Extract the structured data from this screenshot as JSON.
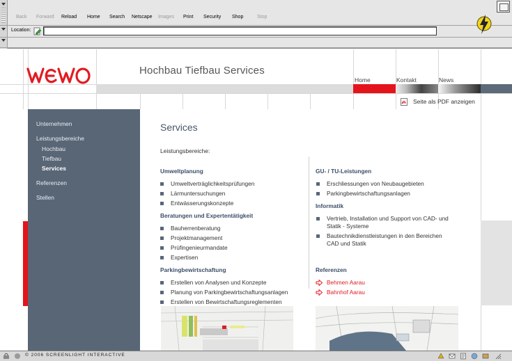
{
  "browser": {
    "toolbar": [
      {
        "label": "Back",
        "enabled": false
      },
      {
        "label": "Forward",
        "enabled": false
      },
      {
        "label": "Reload",
        "enabled": true
      },
      {
        "label": "Home",
        "enabled": true
      },
      {
        "label": "Search",
        "enabled": true
      },
      {
        "label": "Netscape",
        "enabled": true
      },
      {
        "label": "Images",
        "enabled": false
      },
      {
        "label": "Print",
        "enabled": true
      },
      {
        "label": "Security",
        "enabled": true
      },
      {
        "label": "Shop",
        "enabled": true
      },
      {
        "label": "Stop",
        "enabled": false
      }
    ],
    "location_label": "Location:",
    "location_value": "",
    "status_text": "© 2006 SCREENLIGHT INTERACTIVE"
  },
  "site": {
    "logo_text": "WEWO",
    "tagline": "Hochbau Tiefbau Services",
    "topnav": [
      "Home",
      "Kontakt",
      "News"
    ],
    "pdf_link": "Seite als PDF anzeigen",
    "accent_red": "#e4141c",
    "accent_blue": "#596676"
  },
  "sidebar": {
    "items": [
      {
        "label": "Unternehmen",
        "level": 0,
        "active": false
      },
      {
        "label": "Leistungsbereiche",
        "level": 0,
        "active": false
      },
      {
        "label": "Hochbau",
        "level": 1,
        "active": false
      },
      {
        "label": "Tiefbau",
        "level": 1,
        "active": false
      },
      {
        "label": "Services",
        "level": 1,
        "active": true
      },
      {
        "label": "Referenzen",
        "level": 0,
        "active": false
      },
      {
        "label": "Stellen",
        "level": 0,
        "active": false
      }
    ]
  },
  "main": {
    "title": "Services",
    "intro": "Leistungsbereiche:",
    "left_sections": [
      {
        "heading": "Umweltplanung",
        "items": [
          "Umweltverträglichkeitsprüfungen",
          "Lärmuntersuchungen",
          "Entwässerungskonzepte"
        ]
      },
      {
        "heading": "Beratungen und Expertentätigkeit",
        "items": [
          "Bauherrenberatung",
          "Projektmanagement",
          "Prüfingenieurmandate",
          "Expertisen"
        ]
      },
      {
        "heading": "Parkingbewirtschaftung",
        "items": [
          "Erstellen von Analysen und Konzepte",
          "Planung von Parkingbewirtschaftungsanlagen",
          "Erstellen von Bewirtschaftungsreglementen"
        ]
      }
    ],
    "right_sections": [
      {
        "heading": "GU- / TU-Leistungen",
        "items": [
          [
            "Erschliessungen von Neubaugebieten"
          ],
          [
            "Parkingbewirtschaftungsanlagen"
          ]
        ]
      },
      {
        "heading": "Informatik",
        "items": [
          [
            "Vertrieb, Installation und Support von CAD- und",
            "Statik - Systeme"
          ],
          [
            "Bautechnikdienstleistungen in den Bereichen",
            "CAD und Statik"
          ]
        ]
      }
    ],
    "references": {
      "heading": "Referenzen",
      "links": [
        "Behmen Aarau",
        "Bahnhof Aarau"
      ]
    }
  }
}
